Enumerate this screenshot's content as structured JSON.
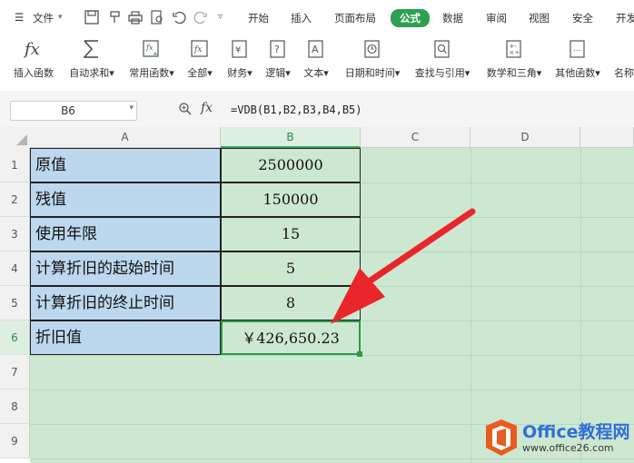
{
  "menubar": {
    "file_label": "文件",
    "tabs": [
      "开始",
      "插入",
      "页面布局",
      "公式",
      "数据",
      "审阅",
      "视图",
      "安全",
      "开发"
    ],
    "active_tab": "公式",
    "accent_color": "#2ea052"
  },
  "ribbon": {
    "buttons": [
      {
        "label": "插入函数",
        "icon": "function-fx-icon"
      },
      {
        "label": "自动求和",
        "icon": "sigma-icon",
        "dropdown": true
      },
      {
        "label": "常用函数",
        "icon": "star-function-icon",
        "dropdown": true
      },
      {
        "label": "全部",
        "icon": "all-functions-icon",
        "dropdown": true
      },
      {
        "label": "财务",
        "icon": "finance-book-icon",
        "dropdown": true
      },
      {
        "label": "逻辑",
        "icon": "logic-question-icon",
        "dropdown": true
      },
      {
        "label": "文本",
        "icon": "text-a-icon",
        "dropdown": true
      },
      {
        "label": "日期和时间",
        "icon": "clock-icon",
        "dropdown": true
      },
      {
        "label": "查找与引用",
        "icon": "search-reference-icon",
        "dropdown": true
      },
      {
        "label": "数学和三角",
        "icon": "math-trig-icon",
        "dropdown": true
      },
      {
        "label": "其他函数",
        "icon": "more-functions-icon",
        "dropdown": true
      },
      {
        "label": "名称",
        "icon": "name-manager-icon"
      }
    ]
  },
  "formula_bar": {
    "cell_ref": "B6",
    "fx": "fx",
    "formula": "=VDB(B1,B2,B3,B4,B5)"
  },
  "columns": [
    "A",
    "B",
    "C",
    "D"
  ],
  "selected_column": "B",
  "rows": [
    {
      "num": "1",
      "label": "原值",
      "value": "2500000"
    },
    {
      "num": "2",
      "label": "残值",
      "value": "150000"
    },
    {
      "num": "3",
      "label": "使用年限",
      "value": "15"
    },
    {
      "num": "4",
      "label": "计算折旧的起始时间",
      "value": "5"
    },
    {
      "num": "5",
      "label": "计算折旧的终止时间",
      "value": "8"
    },
    {
      "num": "6",
      "label": "折旧值",
      "value": "￥426,650.23"
    },
    {
      "num": "7"
    },
    {
      "num": "8"
    },
    {
      "num": "9"
    }
  ],
  "active_row": "6",
  "watermark": {
    "brand": "Office教程网",
    "url": "www.office26.com",
    "brand_color": "#2f6fd6",
    "logo_color": "#e85d1f"
  },
  "annotation_color": "#e8262b"
}
